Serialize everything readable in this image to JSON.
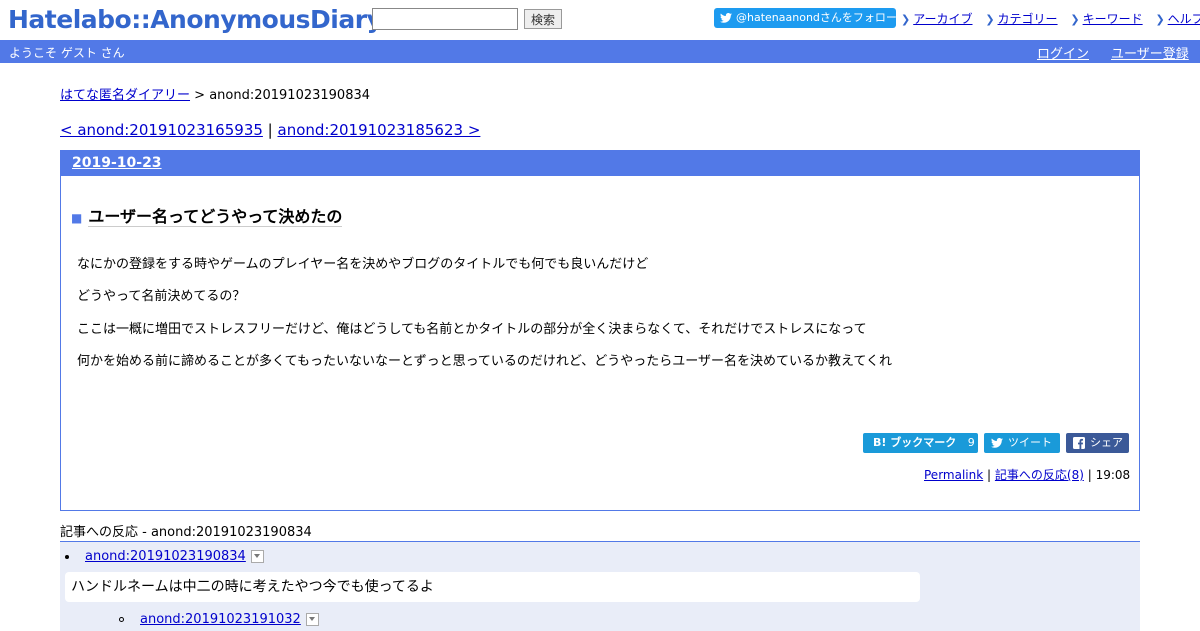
{
  "header": {
    "logo": "Hatelabo::AnonymousDiary",
    "search_placeholder": "",
    "search_button": "検索",
    "twitter_follow": "@hatenaanondさんをフォロー",
    "nav": [
      "アーカイブ",
      "カテゴリー",
      "キーワード",
      "ヘルプ"
    ]
  },
  "banner": {
    "welcome": "ようこそ ゲスト さん",
    "login": "ログイン",
    "register": "ユーザー登録"
  },
  "breadcrumb": {
    "home": "はてな匿名ダイアリー",
    "separator": " > ",
    "current": "anond:20191023190834"
  },
  "pager": {
    "prev": "< anond:20191023165935",
    "separator": " | ",
    "next": "anond:20191023185623 >"
  },
  "day": {
    "date": "2019-10-23",
    "entry": {
      "title": "ユーザー名ってどうやって決めたの",
      "lines": [
        "なにかの登録をする時やゲームのプレイヤー名を決めやブログのタイトルでも何でも良いんだけど",
        "どうやって名前決めてるの？",
        "ここは一概に増田でストレスフリーだけど、俺はどうしても名前とかタイトルの部分が全く決まらなくて、それだけでストレスになって",
        "何かを始める前に諦めることが多くてもったいないなーとずっと思っているのだけれど、どうやったらユーザー名を決めているか教えてくれ"
      ],
      "share": {
        "bookmark_label": "B! ブックマーク",
        "bookmark_count": "9",
        "tweet_label": "ツイート",
        "facebook_label": "シェア"
      },
      "footer": {
        "permalink": "Permalink",
        "reactions": "記事への反応(8)",
        "time": "19:08"
      }
    }
  },
  "references": {
    "title": "記事への反応 - anond:20191023190834",
    "items": [
      {
        "id": "anond:20191023190834",
        "comment": "ハンドルネームは中二の時に考えたやつ今でも使ってるよ"
      },
      {
        "id": "anond:20191023191032"
      }
    ]
  },
  "colors": {
    "accent": "#5279e7",
    "link": "#0000cc",
    "twitter": "#1d9bf0",
    "facebook": "#3b5998"
  }
}
